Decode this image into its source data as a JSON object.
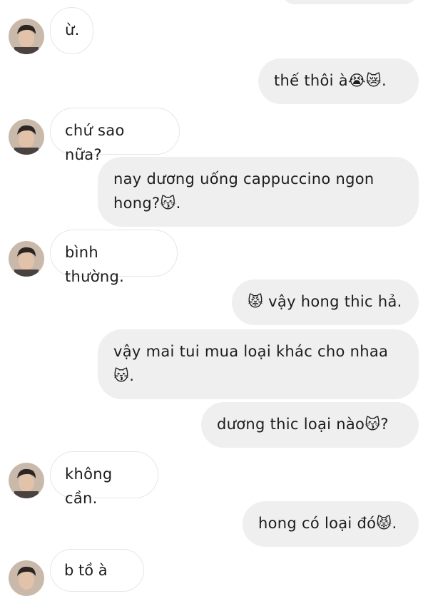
{
  "messages": [
    {
      "side": "in",
      "lines": [
        "ừ."
      ]
    },
    {
      "side": "out",
      "lines": [
        "thế thôi à😭😿."
      ]
    },
    {
      "side": "in",
      "lines": [
        "chứ sao nữa?"
      ]
    },
    {
      "side": "out",
      "lines": [
        "nay dương uống cappuccino ngon",
        "hong?😽."
      ]
    },
    {
      "side": "in",
      "lines": [
        "bình thường."
      ]
    },
    {
      "side": "out",
      "lines": [
        "😾 vậy hong thic hả."
      ]
    },
    {
      "side": "out",
      "lines": [
        "vậy mai tui mua loại khác cho nhaa",
        "😽."
      ]
    },
    {
      "side": "out",
      "lines": [
        "dương thic loại nào😽?"
      ]
    },
    {
      "side": "in",
      "lines": [
        "không cần."
      ]
    },
    {
      "side": "out",
      "lines": [
        "hong có loại đó😾."
      ]
    }
  ],
  "partial_bottom_text": "b    tồ   à",
  "colors": {
    "outgoing_bg": "#efefef",
    "incoming_border": "#e6e6e6"
  }
}
